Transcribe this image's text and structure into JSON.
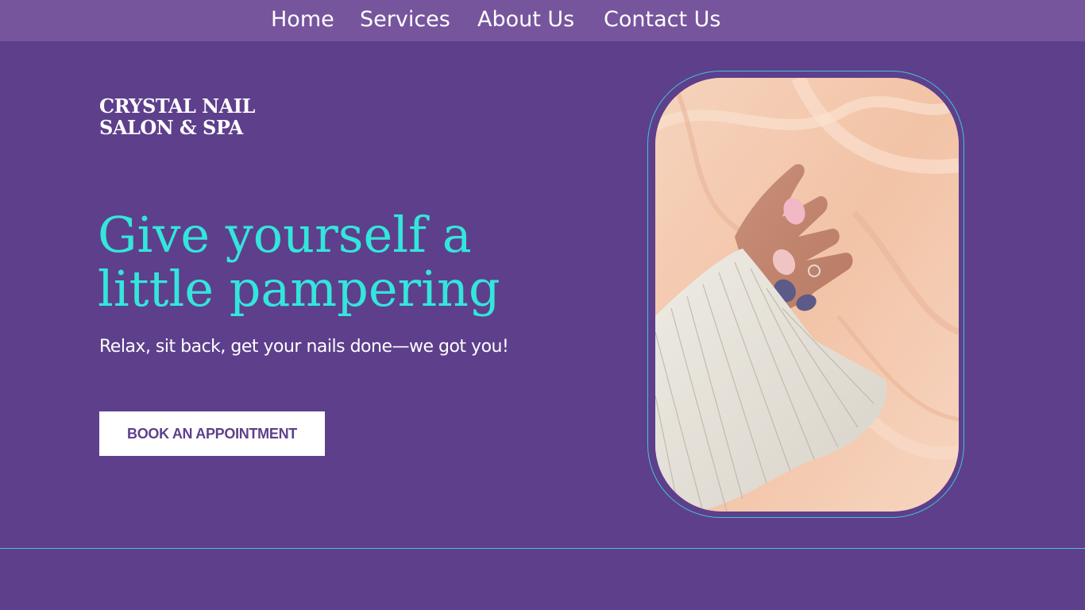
{
  "nav": {
    "items": [
      {
        "label": "Home"
      },
      {
        "label": "Services"
      },
      {
        "label": "About Us"
      },
      {
        "label": "Contact Us"
      }
    ]
  },
  "brand": {
    "line1": "CRYSTAL NAIL",
    "line2": "SALON & SPA"
  },
  "hero": {
    "headline_line1": "Give yourself a",
    "headline_line2": "little pampering",
    "subtitle": "Relax, sit back, get your nails done—we got you!",
    "cta_label": "BOOK AN APPOINTMENT"
  },
  "colors": {
    "background": "#5e3f8c",
    "nav_bar": "#76559d",
    "headline": "#33e6dc",
    "frame_border": "#3ec7d8",
    "cta_text": "#5e3f8c"
  }
}
